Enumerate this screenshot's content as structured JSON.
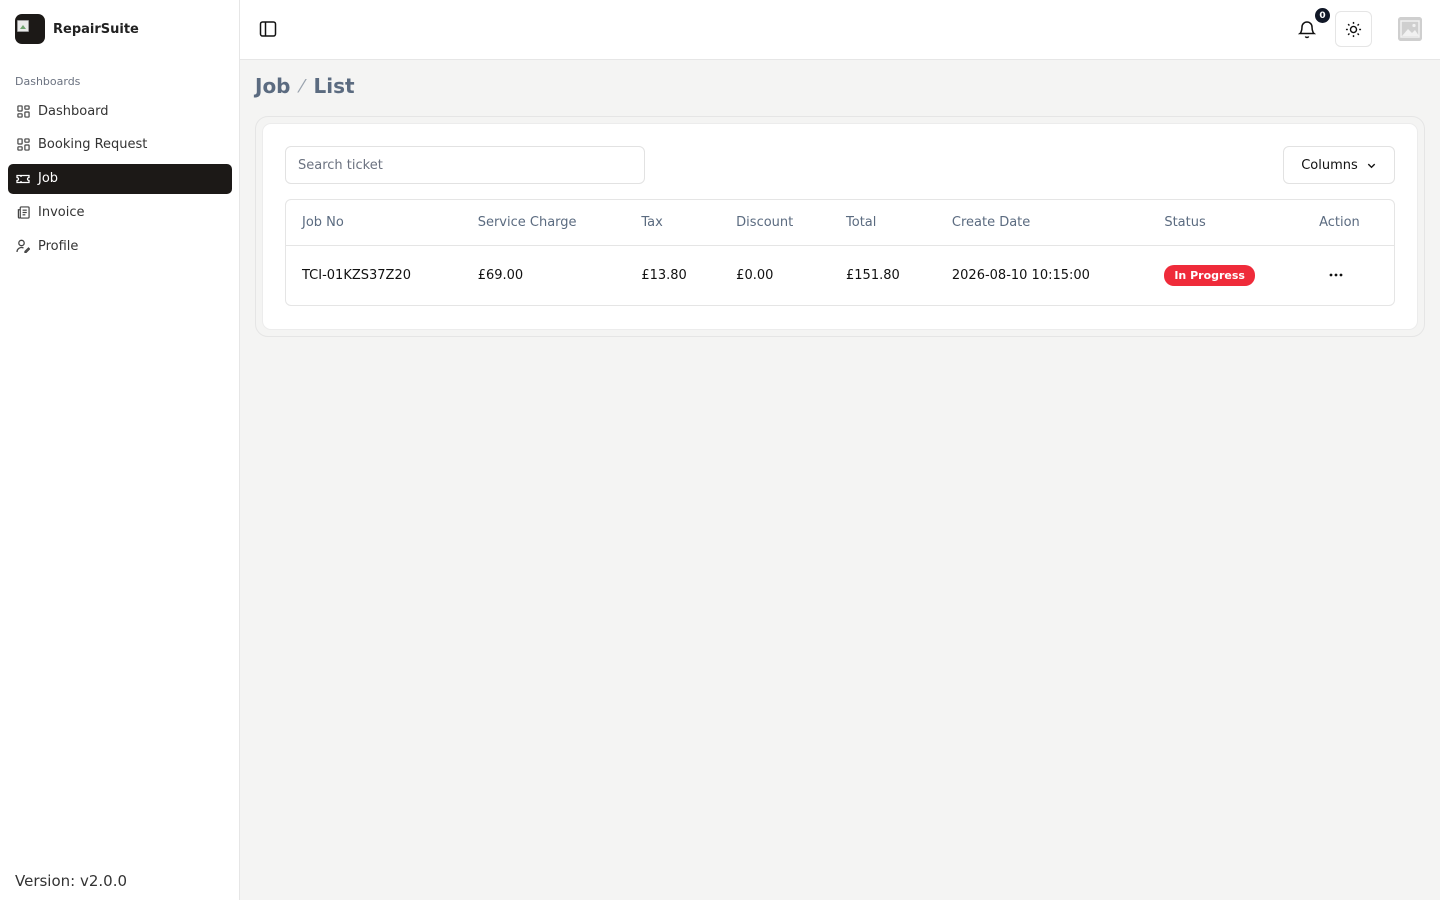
{
  "app": {
    "name": "RepairSuite"
  },
  "sidebar": {
    "section_label": "Dashboards",
    "items": [
      {
        "label": "Dashboard",
        "icon": "grid-icon",
        "active": false
      },
      {
        "label": "Booking Request",
        "icon": "grid-icon",
        "active": false
      },
      {
        "label": "Job",
        "icon": "ticket-icon",
        "active": true
      },
      {
        "label": "Invoice",
        "icon": "receipt-icon",
        "active": false
      },
      {
        "label": "Profile",
        "icon": "user-pen-icon",
        "active": false
      }
    ],
    "version": "Version: v2.0.0"
  },
  "header": {
    "notifications_count": "0"
  },
  "breadcrumb": {
    "items": [
      "Job",
      "List"
    ]
  },
  "toolbar": {
    "search_placeholder": "Search ticket",
    "columns_label": "Columns"
  },
  "table": {
    "headers": [
      "Job No",
      "Service Charge",
      "Tax",
      "Discount",
      "Total",
      "Create Date",
      "Status",
      "Action"
    ],
    "rows": [
      {
        "job_no": "TCI-01KZS37Z20",
        "service_charge": "£69.00",
        "tax": "£13.80",
        "discount": "£0.00",
        "total": "£151.80",
        "create_date": "2026-08-10 10:15:00",
        "status": "In Progress"
      }
    ]
  },
  "colors": {
    "sidebar_active": "#1c1917",
    "status_in_progress": "#ef2b3a",
    "header_text": "#5b6b80"
  }
}
